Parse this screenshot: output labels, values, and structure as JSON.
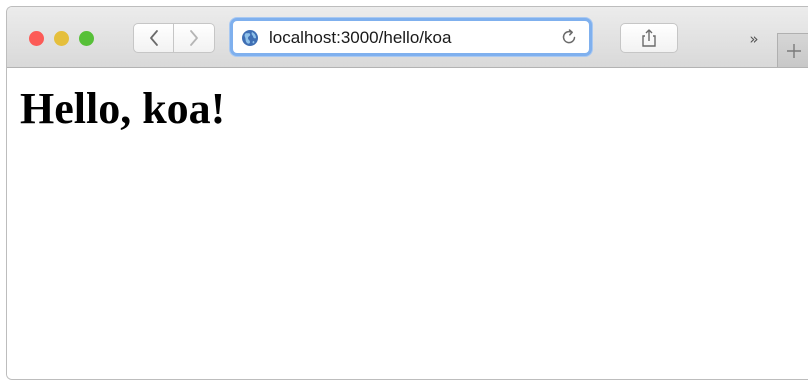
{
  "browser": {
    "window_controls": {
      "close_color": "#fc5b57",
      "minimize_color": "#e5bf3c",
      "maximize_color": "#57c038"
    },
    "toolbar": {
      "back_icon": "chevron-left-icon",
      "forward_icon": "chevron-right-icon",
      "share_icon": "share-icon",
      "overflow_label": "»",
      "new_tab_icon": "plus-icon"
    },
    "address_bar": {
      "url": "localhost:3000/hello/koa",
      "site_icon": "globe-icon",
      "reload_icon": "reload-icon",
      "focus_color": "#7fb0ee"
    }
  },
  "page": {
    "heading": "Hello, koa!"
  }
}
